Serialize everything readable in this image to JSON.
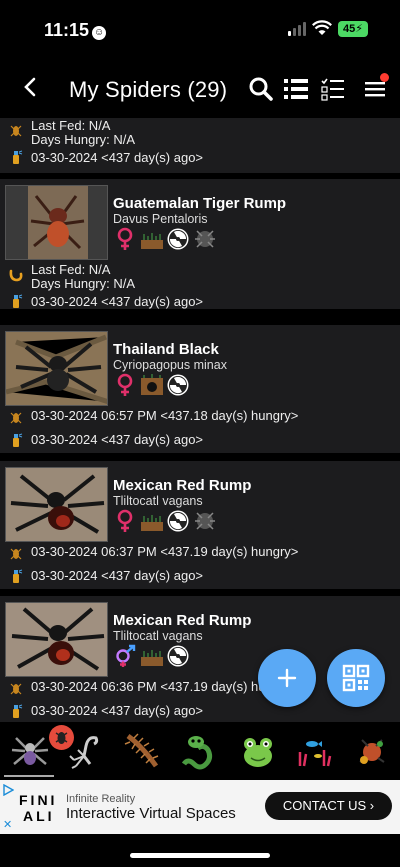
{
  "status_bar": {
    "time": "11:15",
    "battery": "45"
  },
  "header": {
    "title": "My Spiders (29)"
  },
  "top_partial": {
    "last_fed": "Last Fed: N/A",
    "days_hungry": "Days Hungry: N/A",
    "water_date": "03-30-2024 <437 day(s) ago>"
  },
  "cards": [
    {
      "name": "Guatemalan Tiger Rump",
      "scientific": "Davus Pentaloris",
      "sex": "female",
      "line1": "Last Fed: N/A",
      "line2": "Days Hungry: N/A",
      "line3": "03-30-2024 <437 day(s) ago>",
      "line1_icon": "molt-worm-icon"
    },
    {
      "name": "Thailand Black",
      "scientific": "Cyriopagopus minax",
      "sex": "female",
      "line1": "03-30-2024 06:57 PM <437.18 day(s) hungry>",
      "line2": "03-30-2024 <437 day(s) ago>"
    },
    {
      "name": "Mexican Red Rump",
      "scientific": "Tliltocatl vagans",
      "sex": "female",
      "line1": "03-30-2024 06:37 PM <437.19 day(s) hungry>",
      "line2": "03-30-2024 <437 day(s) ago>"
    },
    {
      "name": "Mexican Red Rump",
      "scientific": "Tliltocatl vagans",
      "sex": "unknown",
      "line1": "03-30-2024 06:36 PM <437.19 day(s) hungry>",
      "line2": "03-30-2024 <437 day(s) ago>"
    }
  ],
  "tabs": [
    "tarantula-tab",
    "scorpion-tab",
    "centipede-tab",
    "snake-tab",
    "frog-tab",
    "fish-tab",
    "other-tab"
  ],
  "ad": {
    "logo_top": "FINI",
    "logo_bottom": "ALI",
    "subtitle": "Infinite Reality",
    "title": "Interactive Virtual Spaces",
    "cta": "CONTACT US"
  },
  "colors": {
    "fab": "#5aa9f5",
    "card_bg": "#1c1c1e",
    "female": "#e0306a",
    "badge": "#e54b3c"
  }
}
